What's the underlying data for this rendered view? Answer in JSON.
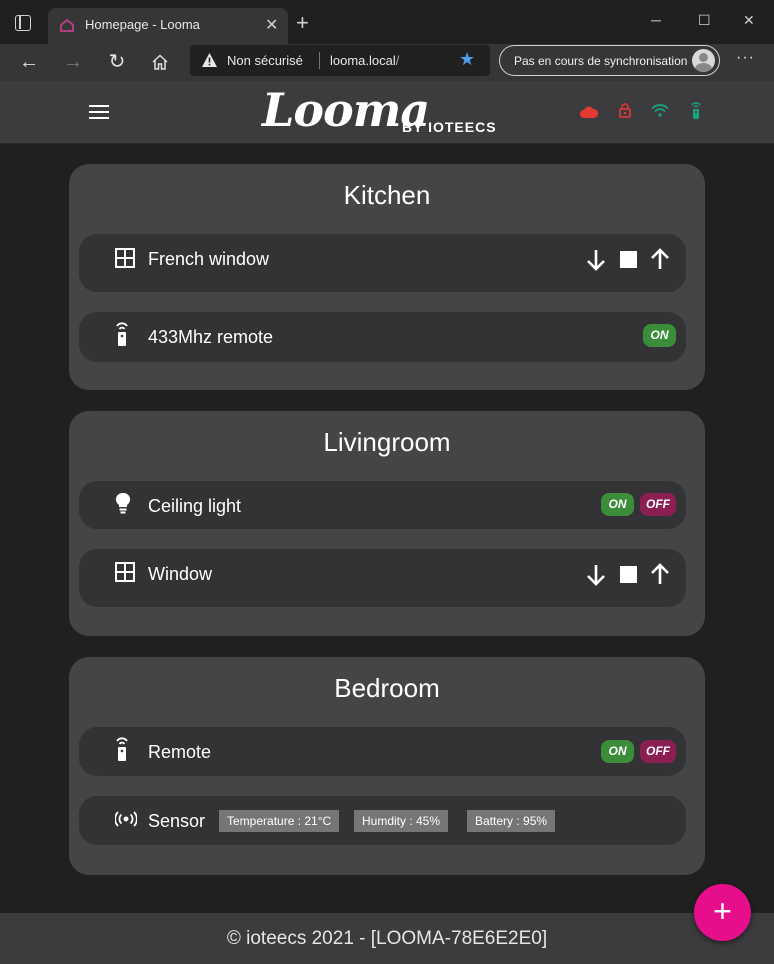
{
  "browser": {
    "tab_title": "Homepage - Looma",
    "insecure_label": "Non sécurisé",
    "url_host": "looma.local",
    "url_path": "/",
    "sync_label": "Pas en cours de synchronisation"
  },
  "header": {
    "logo": "Looma",
    "logo_sub": "BY IOTEECS",
    "status_colors": {
      "cloud": "#e53935",
      "lock": "#e53935",
      "wifi": "#1aa37a",
      "remote": "#1aa37a"
    }
  },
  "rooms": [
    {
      "title": "Kitchen",
      "devices": [
        {
          "label": "French window",
          "icon": "window-icon",
          "control": "shutter"
        },
        {
          "label": "433Mhz remote",
          "icon": "remote-icon",
          "control": "on",
          "on_label": "ON"
        }
      ]
    },
    {
      "title": "Livingroom",
      "devices": [
        {
          "label": "Ceiling light",
          "icon": "bulb-icon",
          "control": "on-off",
          "on_label": "ON",
          "off_label": "OFF"
        },
        {
          "label": "Window",
          "icon": "window-icon",
          "control": "shutter"
        }
      ]
    },
    {
      "title": "Bedroom",
      "devices": [
        {
          "label": "Remote",
          "icon": "remote-icon",
          "control": "on-off",
          "on_label": "ON",
          "off_label": "OFF"
        },
        {
          "label": "Sensor",
          "icon": "sensor-icon",
          "control": "chips",
          "chips": [
            "Temperature : 21°C",
            "Humdity : 45%",
            "Battery : 95%"
          ]
        }
      ]
    }
  ],
  "footer": {
    "text": "© ioteecs 2021 - [LOOMA-78E6E2E0]"
  },
  "fab": {
    "label": "+"
  },
  "colors": {
    "accent": "#e60e8a",
    "on": "#3c8d3a",
    "off": "#8b1f54"
  }
}
